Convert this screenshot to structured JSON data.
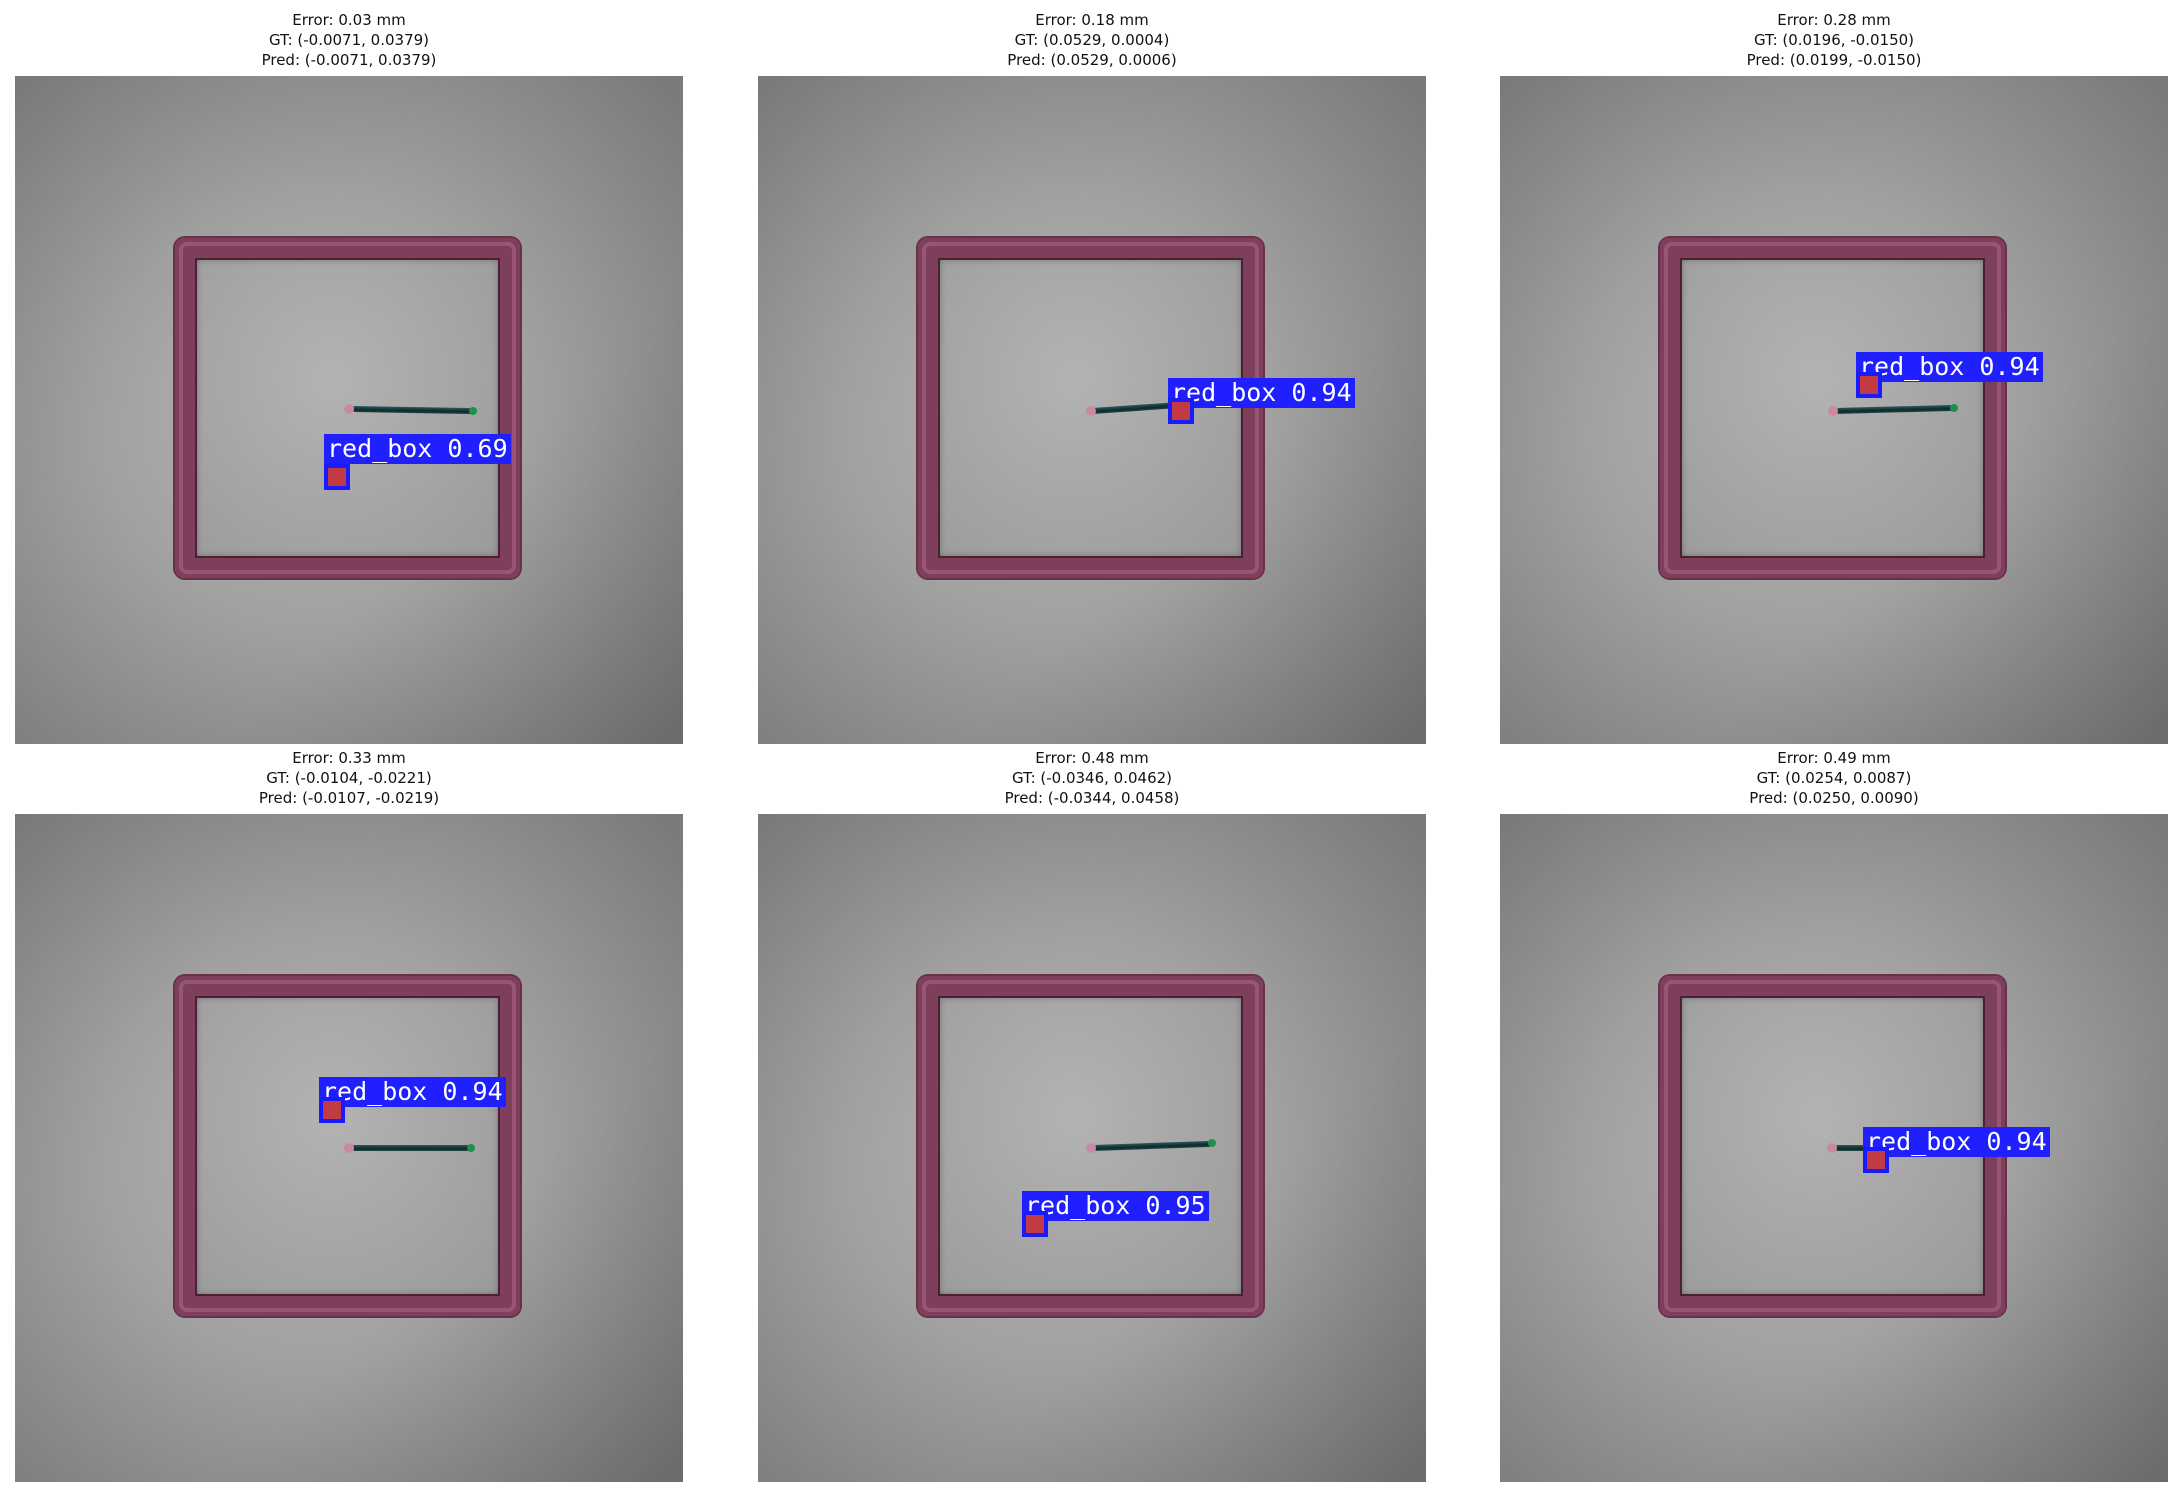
{
  "panels": [
    {
      "error": "Error: 0.03 mm",
      "gt": "GT: (-0.0071, 0.0379)",
      "pred": "Pred: (-0.0071, 0.0379)",
      "detection_label": "red_box 0.69"
    },
    {
      "error": "Error: 0.18 mm",
      "gt": "GT: (0.0529, 0.0004)",
      "pred": "Pred: (0.0529, 0.0006)",
      "detection_label": "red_box 0.94"
    },
    {
      "error": "Error: 0.28 mm",
      "gt": "GT: (0.0196, -0.0150)",
      "pred": "Pred: (0.0199, -0.0150)",
      "detection_label": "red_box 0.94"
    },
    {
      "error": "Error: 0.33 mm",
      "gt": "GT: (-0.0104, -0.0221)",
      "pred": "Pred: (-0.0107, -0.0219)",
      "detection_label": "red_box 0.94"
    },
    {
      "error": "Error: 0.48 mm",
      "gt": "GT: (-0.0346, 0.0462)",
      "pred": "Pred: (-0.0344, 0.0458)",
      "detection_label": "red_box 0.95"
    },
    {
      "error": "Error: 0.49 mm",
      "gt": "GT: (0.0254, 0.0087)",
      "pred": "Pred: (0.0250, 0.0090)",
      "detection_label": "red_box 0.94"
    }
  ],
  "colors": {
    "frame": "#7d3f5b",
    "detection_box": "#1f1fff",
    "target": "#c23a44",
    "rope": "#163638"
  }
}
